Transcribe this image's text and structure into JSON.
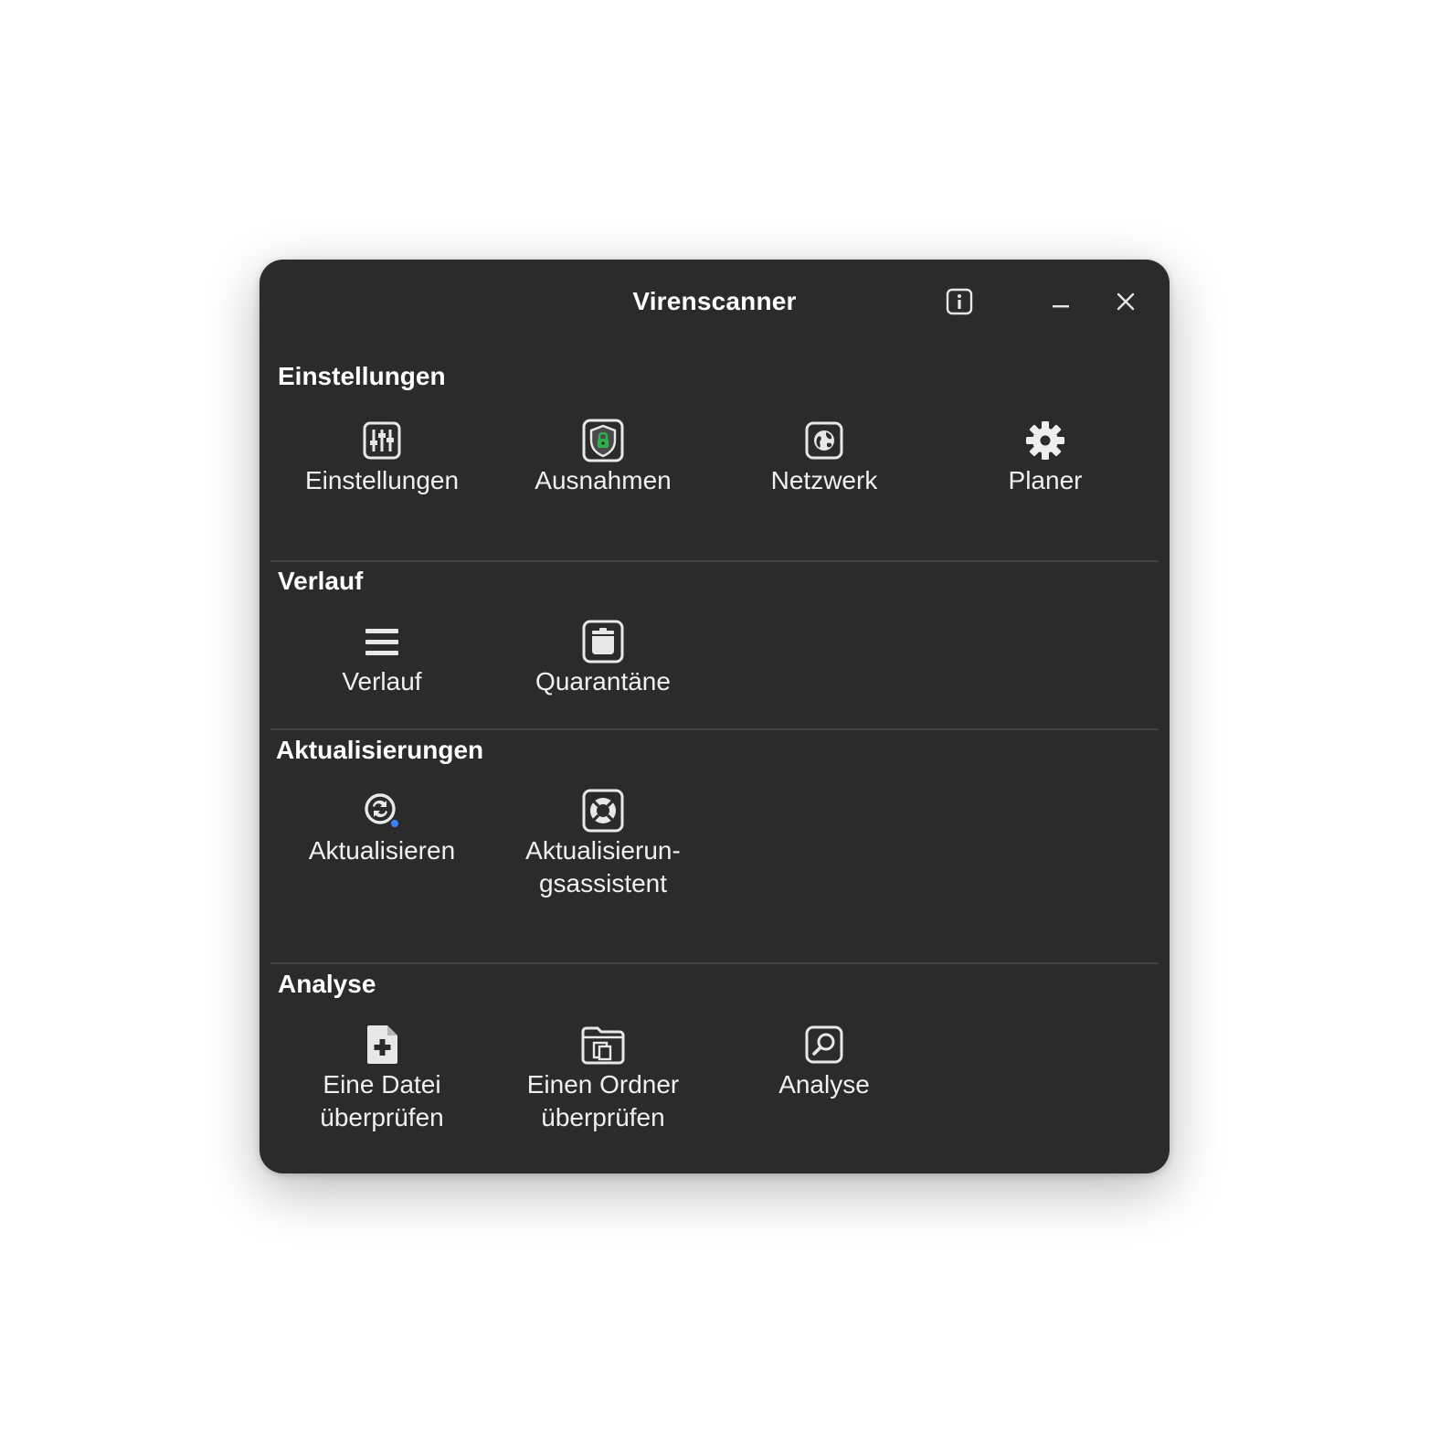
{
  "window": {
    "title": "Virenscanner"
  },
  "titlebar": {
    "info_icon": "info-icon",
    "minimize_icon": "minimize-icon",
    "close_icon": "close-icon"
  },
  "sections": {
    "einstellungen": {
      "title": "Einstellungen",
      "items": [
        {
          "label": "Einstellungen",
          "icon": "sliders-icon"
        },
        {
          "label": "Ausnahmen",
          "icon": "shield-lock-icon"
        },
        {
          "label": "Netzwerk",
          "icon": "globe-icon"
        },
        {
          "label": "Planer",
          "icon": "gear-icon"
        }
      ]
    },
    "verlauf": {
      "title": "Verlauf",
      "items": [
        {
          "label": "Verlauf",
          "icon": "list-icon"
        },
        {
          "label": "Quarantäne",
          "icon": "bin-icon"
        }
      ]
    },
    "aktualisierungen": {
      "title": "Aktualisierungen",
      "items": [
        {
          "label": "Aktualisieren",
          "icon": "refresh-icon"
        },
        {
          "label": "Aktualisierun-\ngsassistent",
          "icon": "lifebuoy-icon"
        }
      ]
    },
    "analyse": {
      "title": "Analyse",
      "items": [
        {
          "label": "Eine Datei\nüberprüfen",
          "icon": "file-add-icon"
        },
        {
          "label": "Einen Ordner\nüberprüfen",
          "icon": "folder-icon"
        },
        {
          "label": "Analyse",
          "icon": "magnifier-icon"
        }
      ]
    }
  },
  "colors": {
    "window_bg": "#2b2b2b",
    "divider": "#414141",
    "text": "#f0f0f0",
    "accent_green": "#2fb04c",
    "accent_blue": "#3b82f6"
  }
}
